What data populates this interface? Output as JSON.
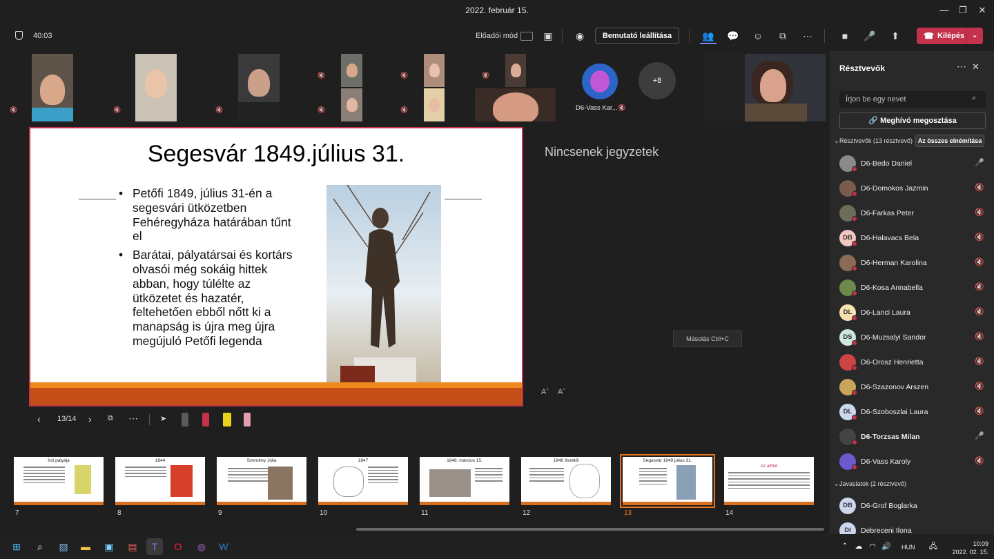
{
  "window": {
    "title": "2022. február 15.",
    "min": "—",
    "max": "❐",
    "close": "✕"
  },
  "toolbar": {
    "timer": "40:03",
    "mode_label": "Előadói mód",
    "stop_presenting": "Bemutató leállítása",
    "leave": "Kilépés"
  },
  "strip": {
    "overflow_count": "+8",
    "bot_name": "D6-Vass Kar..."
  },
  "slide": {
    "title": "Segesvár 1849.július 31.",
    "bullets": [
      "Petőfi 1849, július 31-én a segesvári ütközetben Fehéregyháza határában tűnt el",
      "Barátai, pályatársai és kortárs olvasói még sokáig hittek abban, hogy túlélte az ütközetet és hazatér, feltehetően ebből nőtt ki a manapság is újra meg újra megújuló Petőfi legenda"
    ]
  },
  "notes": {
    "empty_text": "Nincsenek jegyzetek",
    "copy_tip": "Másolás  Ctrl+C",
    "font_up": "Aˆ",
    "font_down": "Aˇ"
  },
  "slide_nav": {
    "counter": "13/14"
  },
  "thumbnails": [
    {
      "num": "7",
      "title": "Írói pályája"
    },
    {
      "num": "8",
      "title": "1844"
    },
    {
      "num": "9",
      "title": "Szendrey Júlia"
    },
    {
      "num": "10",
      "title": "1847"
    },
    {
      "num": "11",
      "title": "1848. március 15."
    },
    {
      "num": "12",
      "title": "1848 őszétől"
    },
    {
      "num": "13",
      "title": "Segesvár 1849.július 31."
    },
    {
      "num": "14",
      "title": "Az alföld"
    }
  ],
  "panel": {
    "title": "Résztvevők",
    "search_placeholder": "Írjon be egy nevet",
    "invite": "Meghívó megosztása",
    "section_participants": "Résztvevők (13 résztvevő)",
    "mute_all": "Az összes elnémítása",
    "participants": [
      {
        "name": "D6-Bedo Daniel",
        "initials": "",
        "mic": "on",
        "color": "#8a8a8a"
      },
      {
        "name": "D6-Domokos Jazmin",
        "initials": "",
        "mic": "off",
        "color": "#7a5b4c"
      },
      {
        "name": "D6-Farkas Peter",
        "initials": "",
        "mic": "off",
        "color": "#6d6d5a"
      },
      {
        "name": "D6-Halavacs Bela",
        "initials": "DB",
        "mic": "off",
        "color": "#f2c6c1"
      },
      {
        "name": "D6-Herman Karolina",
        "initials": "",
        "mic": "off",
        "color": "#8c6b55"
      },
      {
        "name": "D6-Kosa Annabella",
        "initials": "",
        "mic": "off",
        "color": "#6c8a4c"
      },
      {
        "name": "D6-Lanci Laura",
        "initials": "DL",
        "mic": "off",
        "color": "#f6e1b0"
      },
      {
        "name": "D6-Muzsalyi Sandor",
        "initials": "DS",
        "mic": "off",
        "color": "#cde7dc"
      },
      {
        "name": "D6-Orosz Henrietta",
        "initials": "",
        "mic": "off",
        "color": "#c44"
      },
      {
        "name": "D6-Szazonov Arszen",
        "initials": "",
        "mic": "off",
        "color": "#c9a55a"
      },
      {
        "name": "D6-Szoboszlai Laura",
        "initials": "DL",
        "mic": "off",
        "color": "#cdd8ee"
      },
      {
        "name": "D6-Torzsas Milan",
        "initials": "",
        "mic": "on",
        "color": "#444"
      },
      {
        "name": "D6-Vass Karoly",
        "initials": "",
        "mic": "off",
        "color": "#6a5acd"
      }
    ],
    "section_suggestions": "Javaslatok (2 résztvevő)",
    "suggestions": [
      {
        "name": "D6-Grof Boglarka",
        "initials": "DB",
        "color": "#cdd8ee"
      },
      {
        "name": "Debreceni Ilona",
        "initials": "DI",
        "color": "#cdd8ee"
      }
    ]
  },
  "taskbar": {
    "lang": "HUN",
    "time": "10:09",
    "date": "2022. 02. 15."
  }
}
